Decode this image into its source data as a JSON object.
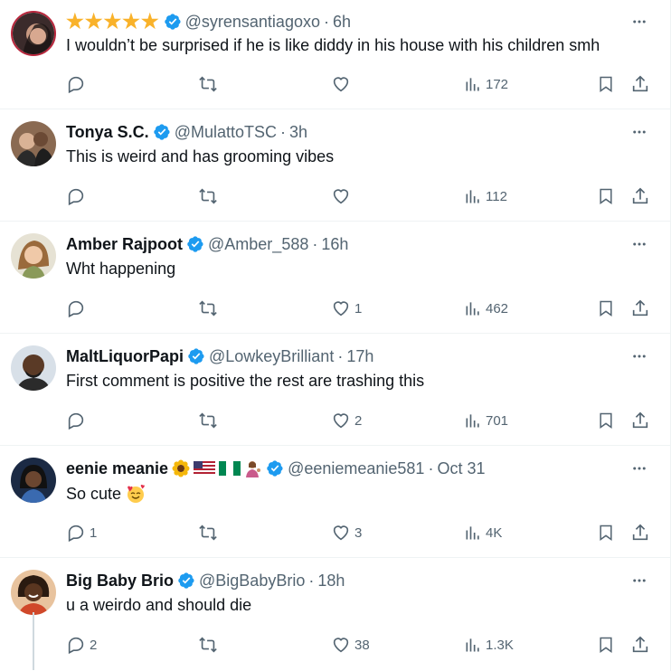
{
  "colors": {
    "verified": "#1d9bf0",
    "secondary_text": "#536471",
    "primary_text": "#0f1419",
    "star": "#f9b22a"
  },
  "tweets": [
    {
      "name": "★★★★★",
      "name_is_stars": true,
      "handle": "@syrensantiagoxo",
      "time": "6h",
      "text": "I wouldn’t be surprised if he is like diddy in his house with his children smh",
      "replies": "",
      "likes": "",
      "views": "172",
      "avatar_icon": "avatar-photo"
    },
    {
      "name": "Tonya S.C.",
      "handle": "@MulattoTSC",
      "time": "3h",
      "text": "This is weird and has grooming vibes",
      "replies": "",
      "likes": "",
      "views": "112",
      "avatar_icon": "avatar-photo"
    },
    {
      "name": "Amber Rajpoot",
      "handle": "@Amber_588",
      "time": "16h",
      "text": "Wht happening",
      "replies": "",
      "likes": "1",
      "views": "462",
      "avatar_icon": "avatar-photo"
    },
    {
      "name": "MaltLiquorPapi",
      "handle": "@LowkeyBrilliant",
      "time": "17h",
      "text": "First comment is positive the rest are trashing this",
      "replies": "",
      "likes": "2",
      "views": "701",
      "avatar_icon": "avatar-photo"
    },
    {
      "name": "eenie meanie",
      "name_emojis": [
        "sunflower",
        "us-flag",
        "nigeria-flag",
        "person-tipping-hand"
      ],
      "handle": "@eeniemeanie581",
      "time": "Oct 31",
      "text": "So cute",
      "text_emoji": "smiling-face-with-hearts",
      "replies": "1",
      "likes": "3",
      "views": "4K",
      "avatar_icon": "avatar-photo"
    },
    {
      "name": "Big Baby Brio",
      "handle": "@BigBabyBrio",
      "time": "18h",
      "text": "u a weirdo and should die",
      "replies": "2",
      "likes": "38",
      "views": "1.3K",
      "avatar_icon": "avatar-photo"
    }
  ]
}
